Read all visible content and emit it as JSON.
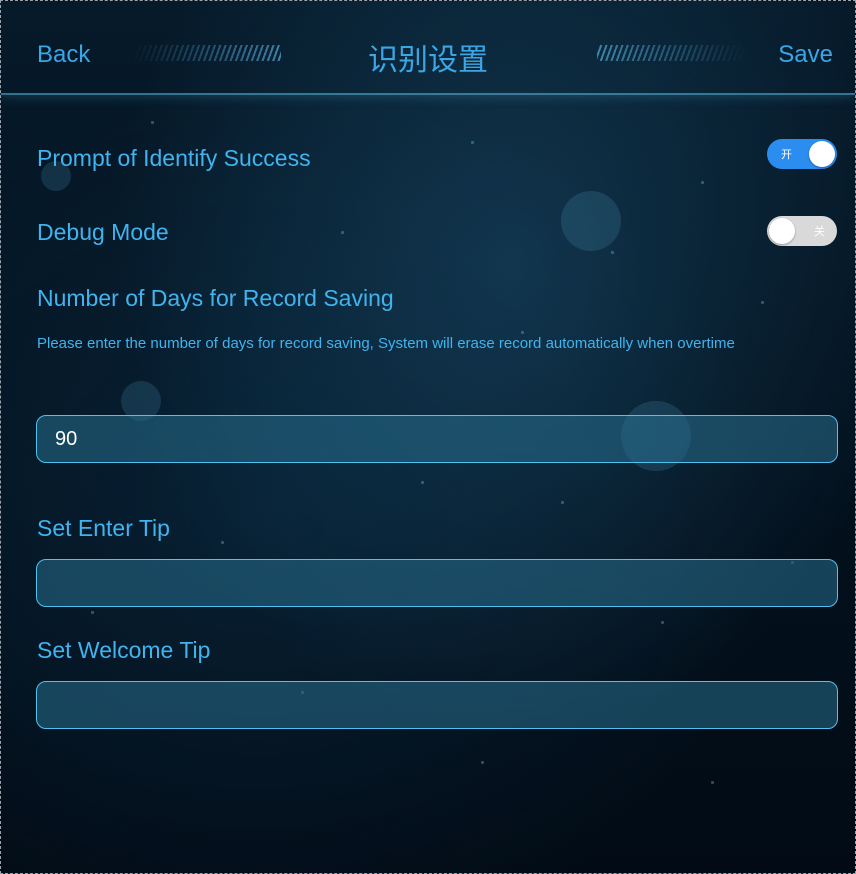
{
  "header": {
    "back_label": "Back",
    "title": "识别设置",
    "save_label": "Save"
  },
  "settings": {
    "prompt_success": {
      "label": "Prompt of Identify Success",
      "toggle_text": "开",
      "enabled": true
    },
    "debug_mode": {
      "label": "Debug Mode",
      "toggle_text": "关",
      "enabled": false
    },
    "record_days": {
      "label": "Number of Days for Record Saving",
      "description": "Please enter the number of days for record saving, System will erase record automatically when overtime",
      "value": "90"
    },
    "enter_tip": {
      "label": "Set Enter Tip",
      "value": ""
    },
    "welcome_tip": {
      "label": "Set Welcome Tip",
      "value": ""
    }
  },
  "colors": {
    "accent": "#41b3ee",
    "toggle_on": "#2c8df0",
    "toggle_off": "#d9d9d9",
    "background": "#03121f"
  }
}
